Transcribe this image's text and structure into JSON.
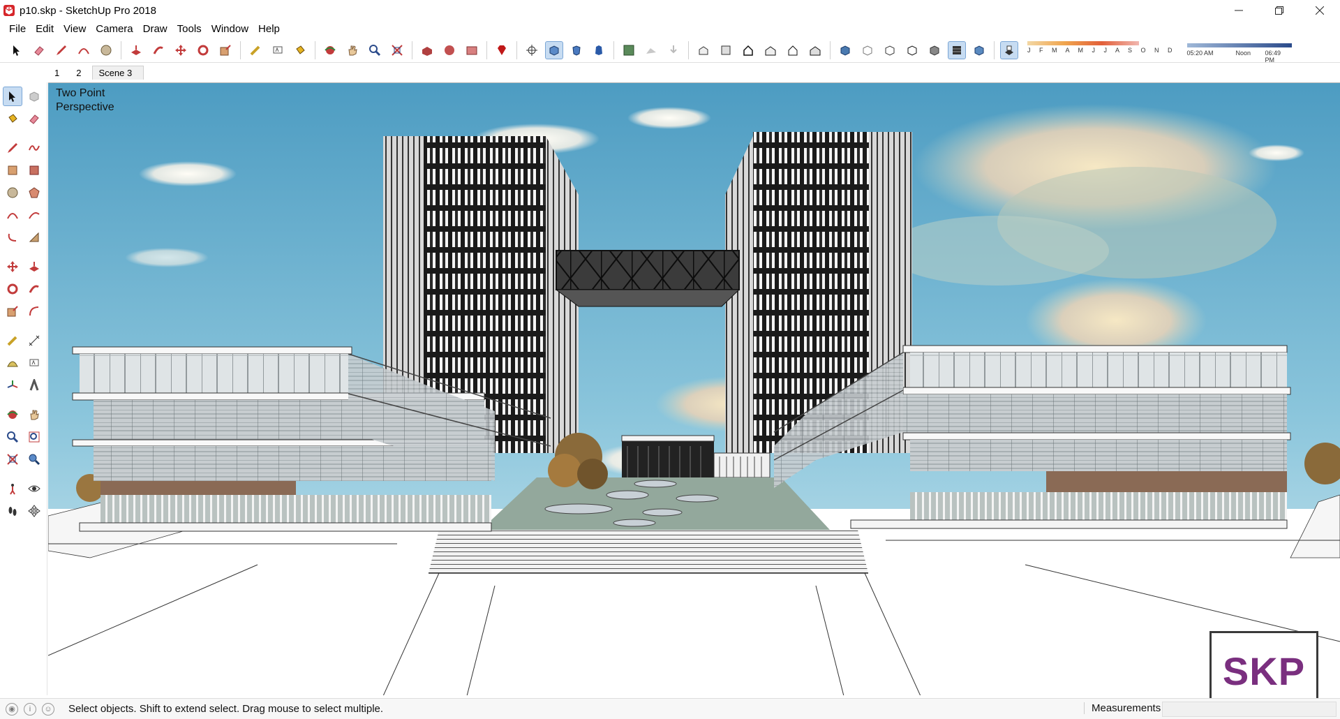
{
  "window": {
    "title": "p10.skp - SketchUp Pro 2018",
    "controls": [
      "minimize",
      "restore",
      "close"
    ]
  },
  "menu": [
    "File",
    "Edit",
    "View",
    "Camera",
    "Draw",
    "Tools",
    "Window",
    "Help"
  ],
  "toolbar": {
    "shadow_months": "J F M A M J J A S O N D",
    "time_start": "05:20 AM",
    "time_mid": "Noon",
    "time_end": "06:49 PM"
  },
  "scenes": [
    "1",
    "2",
    "Scene 3"
  ],
  "active_scene": "Scene 3",
  "viewport": {
    "label_line1": "Two Point",
    "label_line2": "Perspective"
  },
  "watermark": "SKP",
  "status": {
    "message": "Select objects. Shift to extend select. Drag mouse to select multiple.",
    "measurements_label": "Measurements"
  }
}
